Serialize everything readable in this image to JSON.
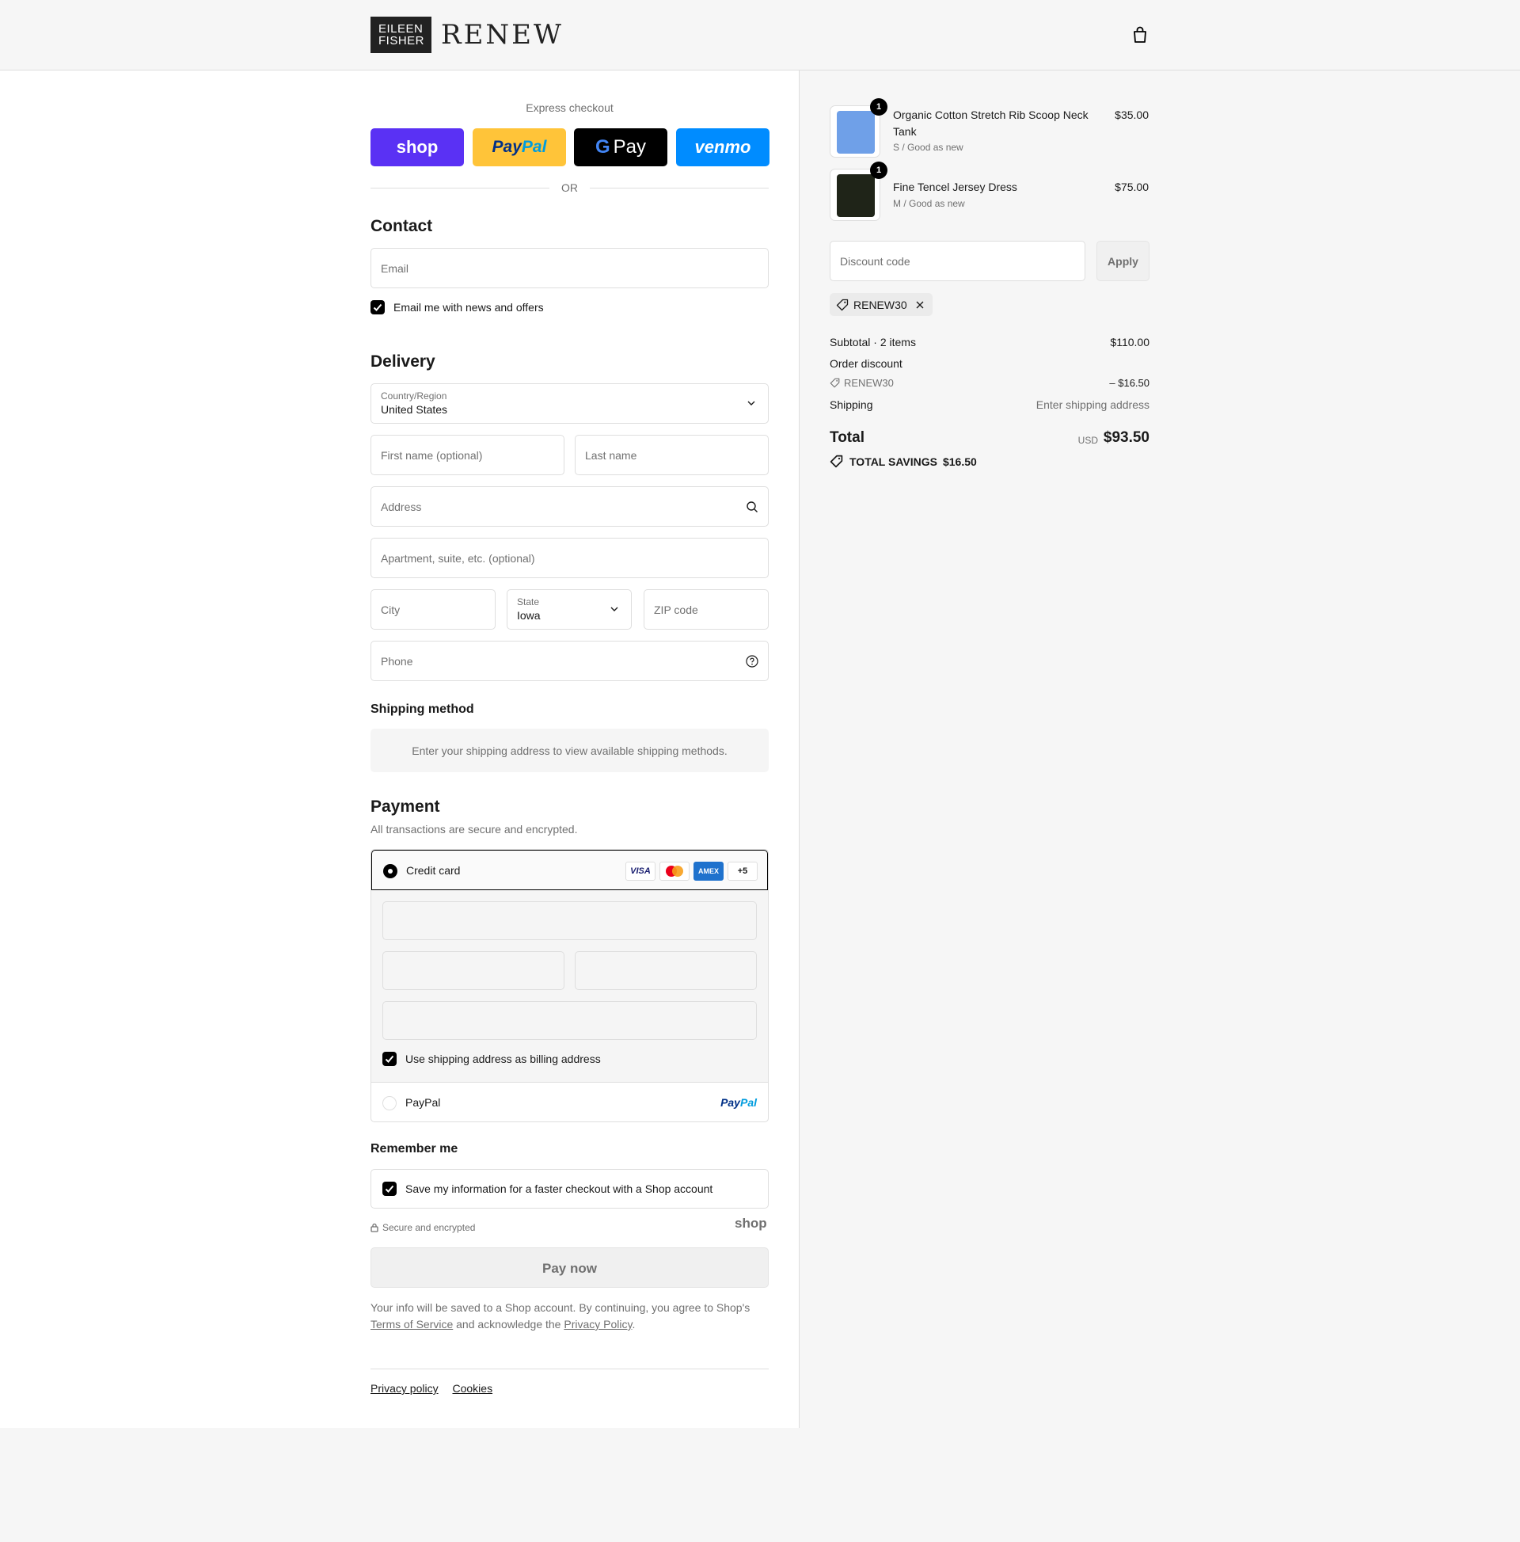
{
  "header": {
    "logo_line1": "EILEEN",
    "logo_line2": "FISHER",
    "logo_brand": "RENEW"
  },
  "express": {
    "title": "Express checkout",
    "shop": "shop",
    "paypal_a": "Pay",
    "paypal_b": "Pal",
    "gpay_g": "G",
    "gpay_text": "Pay",
    "venmo": "venmo",
    "or": "OR"
  },
  "contact": {
    "title": "Contact",
    "email_placeholder": "Email",
    "newsletter_label": "Email me with news and offers",
    "newsletter_checked": true
  },
  "delivery": {
    "title": "Delivery",
    "country_label": "Country/Region",
    "country_value": "United States",
    "first_name_placeholder": "First name (optional)",
    "last_name_placeholder": "Last name",
    "address_placeholder": "Address",
    "apartment_placeholder": "Apartment, suite, etc. (optional)",
    "city_placeholder": "City",
    "state_label": "State",
    "state_value": "Iowa",
    "zip_placeholder": "ZIP code",
    "phone_placeholder": "Phone"
  },
  "shipping_method": {
    "title": "Shipping method",
    "message": "Enter your shipping address to view available shipping methods."
  },
  "payment": {
    "title": "Payment",
    "subtitle": "All transactions are secure and encrypted.",
    "credit_card_label": "Credit card",
    "cards": [
      "VISA",
      "MC",
      "AMEX",
      "+5"
    ],
    "billing_label": "Use shipping address as billing address",
    "paypal_label": "PayPal",
    "paypal_logo_a": "Pay",
    "paypal_logo_b": "Pal"
  },
  "remember": {
    "title": "Remember me",
    "save_label": "Save my information for a faster checkout with a Shop account"
  },
  "secure_text": "Secure and encrypted",
  "shop_mark": "shop",
  "pay_now": "Pay now",
  "legal": {
    "text1": "Your info will be saved to a Shop account. By continuing, you agree to Shop's",
    "terms": "Terms of Service",
    "text2": "and acknowledge the",
    "privacy": "Privacy Policy",
    "text3": "."
  },
  "footer": {
    "privacy_policy": "Privacy policy",
    "cookies": "Cookies"
  },
  "cart": {
    "items": [
      {
        "name": "Organic Cotton Stretch Rib Scoop Neck Tank",
        "variant": "S / Good as new",
        "price": "$35.00",
        "qty": "1",
        "color": "#6fa0e8"
      },
      {
        "name": "Fine Tencel Jersey Dress",
        "variant": "M / Good as new",
        "price": "$75.00",
        "qty": "1",
        "color": "#1f2418"
      }
    ],
    "discount_placeholder": "Discount code",
    "apply": "Apply",
    "applied_code": "RENEW30",
    "subtotal_label": "Subtotal · 2 items",
    "subtotal_value": "$110.00",
    "order_discount_label": "Order discount",
    "discount_code": "RENEW30",
    "discount_value": "– $16.50",
    "shipping_label": "Shipping",
    "shipping_value": "Enter shipping address",
    "total_label": "Total",
    "total_currency": "USD",
    "total_value": "$93.50",
    "savings_label": "TOTAL SAVINGS",
    "savings_value": "$16.50"
  }
}
